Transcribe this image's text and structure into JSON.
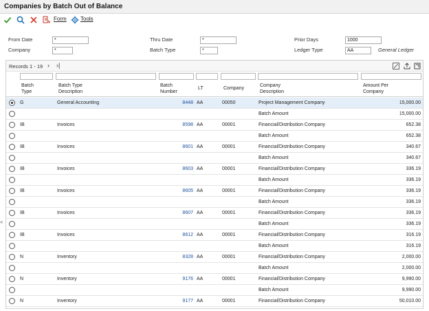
{
  "title": "Companies by Batch Out of Balance",
  "toolbar": {
    "form_label": "Form",
    "tools_label": "Tools"
  },
  "form": {
    "from_date_label": "From Date",
    "from_date_value": "*",
    "thru_date_label": "Thru Date",
    "thru_date_value": "*",
    "prior_days_label": "Prior Days",
    "prior_days_value": "1000",
    "company_label": "Company",
    "company_value": "*",
    "batch_type_label": "Batch Type",
    "batch_type_value": "*",
    "ledger_type_label": "Ledger Type",
    "ledger_type_value": "AA",
    "ledger_type_desc": "General Ledger"
  },
  "grid": {
    "records_label": "Records 1 - 19",
    "headers": {
      "batch_type": [
        "Batch",
        "Type"
      ],
      "batch_type_desc": [
        "Batch Type",
        "Description"
      ],
      "batch_number": [
        "Batch",
        "Number"
      ],
      "lt": "LT",
      "company": "Company",
      "company_desc": [
        "Company",
        "Description"
      ],
      "amount": [
        "Amount Per",
        "Company"
      ]
    },
    "rows": [
      {
        "type": "G",
        "type_desc": "General Accounting",
        "batch": "8448",
        "lt": "AA",
        "company": "00050",
        "company_desc": "Project Management Company",
        "amount": "15,000.00",
        "selected": true
      },
      {
        "type": "",
        "type_desc": "",
        "batch": "",
        "lt": "",
        "company": "",
        "company_desc": "Batch Amount",
        "amount": "15,000.00"
      },
      {
        "type": "IB",
        "type_desc": "Invoices",
        "batch": "8598",
        "lt": "AA",
        "company": "00001",
        "company_desc": "Financial/Distribution Company",
        "amount": "652.38"
      },
      {
        "type": "",
        "type_desc": "",
        "batch": "",
        "lt": "",
        "company": "",
        "company_desc": "Batch Amount",
        "amount": "652.38"
      },
      {
        "type": "IB",
        "type_desc": "Invoices",
        "batch": "8601",
        "lt": "AA",
        "company": "00001",
        "company_desc": "Financial/Distribution Company",
        "amount": "340.67"
      },
      {
        "type": "",
        "type_desc": "",
        "batch": "",
        "lt": "",
        "company": "",
        "company_desc": "Batch Amount",
        "amount": "340.67"
      },
      {
        "type": "IB",
        "type_desc": "Invoices",
        "batch": "8603",
        "lt": "AA",
        "company": "00001",
        "company_desc": "Financial/Distribution Company",
        "amount": "336.19"
      },
      {
        "type": "",
        "type_desc": "",
        "batch": "",
        "lt": "",
        "company": "",
        "company_desc": "Batch Amount",
        "amount": "336.19"
      },
      {
        "type": "IB",
        "type_desc": "Invoices",
        "batch": "8605",
        "lt": "AA",
        "company": "00001",
        "company_desc": "Financial/Distribution Company",
        "amount": "336.19"
      },
      {
        "type": "",
        "type_desc": "",
        "batch": "",
        "lt": "",
        "company": "",
        "company_desc": "Batch Amount",
        "amount": "336.19"
      },
      {
        "type": "IB",
        "type_desc": "Invoices",
        "batch": "8607",
        "lt": "AA",
        "company": "00001",
        "company_desc": "Financial/Distribution Company",
        "amount": "336.19"
      },
      {
        "type": "",
        "type_desc": "",
        "batch": "",
        "lt": "",
        "company": "",
        "company_desc": "Batch Amount",
        "amount": "336.19"
      },
      {
        "type": "IB",
        "type_desc": "Invoices",
        "batch": "8612",
        "lt": "AA",
        "company": "00001",
        "company_desc": "Financial/Distribution Company",
        "amount": "316.19"
      },
      {
        "type": "",
        "type_desc": "",
        "batch": "",
        "lt": "",
        "company": "",
        "company_desc": "Batch Amount",
        "amount": "316.19"
      },
      {
        "type": "N",
        "type_desc": "Inventory",
        "batch": "8328",
        "lt": "AA",
        "company": "00001",
        "company_desc": "Financial/Distribution Company",
        "amount": "2,000.00"
      },
      {
        "type": "",
        "type_desc": "",
        "batch": "",
        "lt": "",
        "company": "",
        "company_desc": "Batch Amount",
        "amount": "2,000.00"
      },
      {
        "type": "N",
        "type_desc": "Inventory",
        "batch": "9176",
        "lt": "AA",
        "company": "00001",
        "company_desc": "Financial/Distribution Company",
        "amount": "9,990.00"
      },
      {
        "type": "",
        "type_desc": "",
        "batch": "",
        "lt": "",
        "company": "",
        "company_desc": "Batch Amount",
        "amount": "9,990.00"
      },
      {
        "type": "N",
        "type_desc": "Inventory",
        "batch": "9177",
        "lt": "AA",
        "company": "00001",
        "company_desc": "Financial/Distribution Company",
        "amount": "50,010.00"
      }
    ]
  },
  "colors": {
    "accent_ok": "#3a9a2b",
    "accent_cancel": "#d33a2c",
    "link": "#1c4f9c",
    "selected_row": "#e4eef8"
  },
  "icons": {
    "ok": "checkmark-icon",
    "find": "search-icon",
    "cancel": "close-icon",
    "form_menu": "form-icon",
    "tools_menu": "gear-icon",
    "next": "chevron-right-icon",
    "last": "last-page-icon",
    "grid_tools": [
      "personalize-icon",
      "export-icon",
      "fullscreen-icon"
    ]
  }
}
